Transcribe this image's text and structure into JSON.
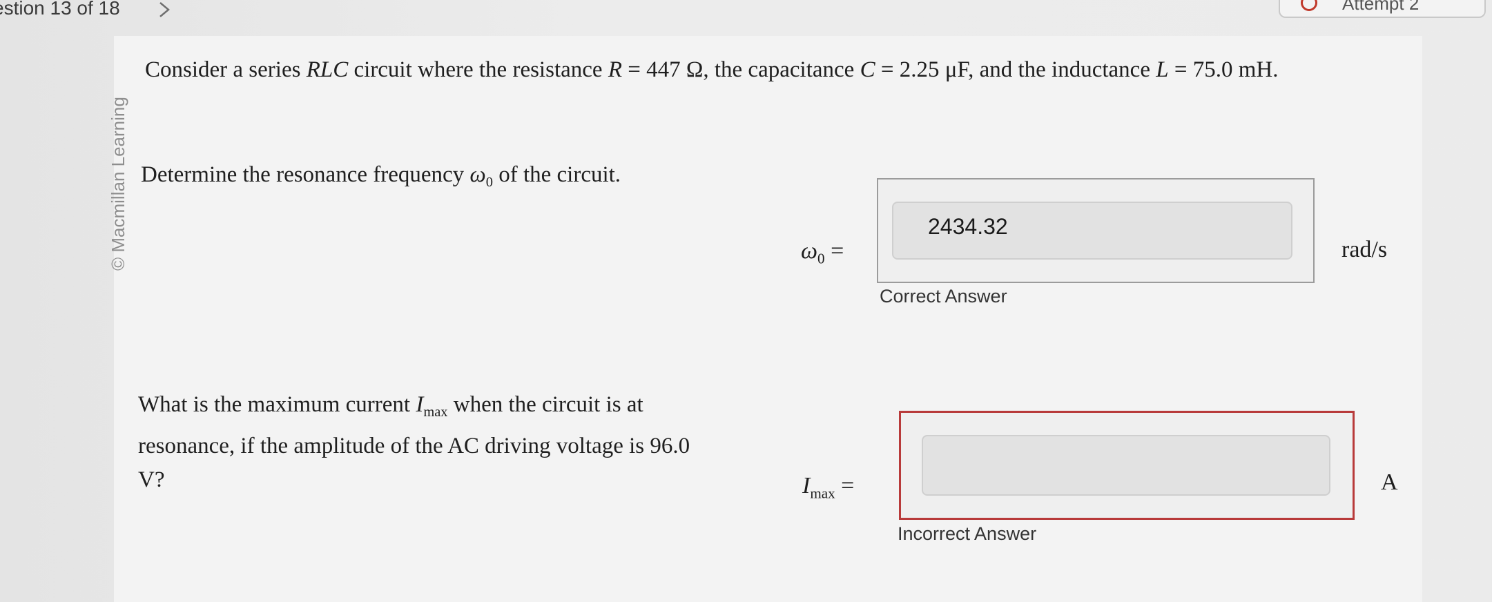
{
  "header": {
    "question_counter": "estion 13 of 18",
    "next_icon": "chevron-right-icon",
    "attempt_label": "Attempt 2",
    "attempt_icon_color": "#c0392b"
  },
  "watermark": "© Macmillan Learning",
  "problem": {
    "intro_prefix": "Consider a series ",
    "intro_rlc": "RLC",
    "intro_mid1": " circuit where the resistance ",
    "intro_R": "R",
    "intro_R_val": " = 447 Ω, the capacitance ",
    "intro_C": "C",
    "intro_C_val": " = 2.25 μF, and the inductance ",
    "intro_L": "L",
    "intro_L_val": " = 75.0 mH."
  },
  "part1": {
    "prompt_prefix": "Determine the resonance frequency ",
    "prompt_symbol": "ω",
    "prompt_sub": "0",
    "prompt_suffix": " of the circuit.",
    "label_symbol": "ω",
    "label_sub": "0",
    "label_equals": " =",
    "answer_value": "2434.32",
    "unit": "rad/s",
    "status": "Correct Answer",
    "frame_color": "#9b9b9b"
  },
  "part2": {
    "prompt_line1_prefix": "What is the maximum current ",
    "prompt_symbol": "I",
    "prompt_sub": "max",
    "prompt_line1_suffix": " when the circuit is at resonance, if the amplitude of the AC driving voltage is 96.0 V?",
    "label_symbol": "I",
    "label_sub": "max",
    "label_equals": " =",
    "answer_value": "",
    "unit": "A",
    "status": "Incorrect Answer",
    "frame_color": "#b83a3a"
  }
}
